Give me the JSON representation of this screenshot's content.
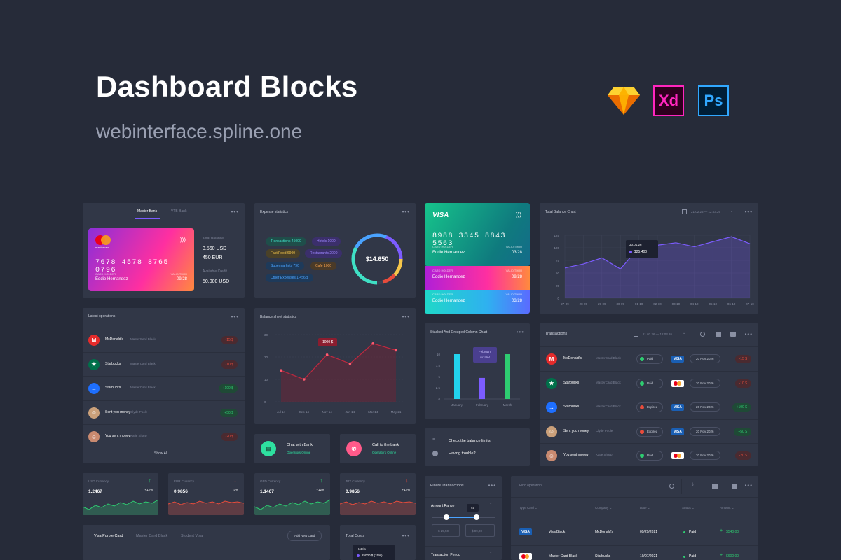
{
  "hero": {
    "title": "Dashboard Blocks",
    "subtitle": "webinterface.spline.one",
    "tools": [
      "sketch-icon",
      "Xd",
      "Ps"
    ]
  },
  "bank_panel": {
    "tabs": [
      "Master Bank",
      "VTB Bank"
    ],
    "card_number": "7678 4578 8765 0796",
    "card_brand": "mastercard",
    "card_holder_label": "CARD HOLDER",
    "card_holder": "Eddie Hernandez",
    "valid_label": "VALID THRU",
    "valid": "09/28",
    "total_label": "Total Balance",
    "usd": "3.560 USD",
    "eur": "450 EUR",
    "credit_label": "Available Credit",
    "credit": "50.000 USD"
  },
  "expense": {
    "title": "Expense statistics",
    "tags": [
      "Transactions 45000",
      "Hotels 1000",
      "Fast Food 6900",
      "Restaurants 2000",
      "Supermarkets 790",
      "Cafe 1000",
      "Other Expenses 1.456 $"
    ],
    "total": "$14.650"
  },
  "cards_stack": {
    "brand": "VISA",
    "number": "8988 3345 8843 5563",
    "holder_label": "CARD HOLDER",
    "valid_label": "VALID THRU",
    "holder": "Eddie Hernandez",
    "valid": "03/28",
    "card2_holder": "Eddie Hernandez",
    "card2_valid": "09/28",
    "card3_holder": "Eddie Hernandez",
    "card3_valid": "03/28"
  },
  "balance_chart": {
    "title": "Total Balance Chart",
    "range": "21.02.26 — 12.03.26",
    "tooltip_date": "30.01.26",
    "tooltip_value": "$25.400"
  },
  "latest_ops": {
    "title": "Latest operations",
    "rows": [
      {
        "name": "McDonald's",
        "card": "MasterCard Black",
        "amount": "-15 $"
      },
      {
        "name": "Starbucks",
        "card": "MasterCard Black",
        "amount": "-10 $"
      },
      {
        "name": "Starbucks",
        "card": "MasterCard Black",
        "amount": "+100 $"
      },
      {
        "name": "Sent you money",
        "card": "Clyde Poole",
        "amount": "+50 $"
      },
      {
        "name": "You sent money",
        "card": "Katie Sharp",
        "amount": "-20 $"
      }
    ],
    "show_all": "Show All"
  },
  "balance_sheet": {
    "title": "Balance sheet statistics",
    "tooltip": "1000 $"
  },
  "stacked": {
    "title": "Stacked And Grouped Column Chart",
    "tooltip_month": "February",
    "tooltip_value": "$7.400"
  },
  "transactions": {
    "title": "Transactions",
    "range": "21.02.26 — 12.03.26",
    "rows": [
      {
        "name": "McDonald's",
        "card": "MasterCard Black",
        "status": "Paid",
        "date": "20 Nov 2026",
        "amount": "-15 $"
      },
      {
        "name": "Starbucks",
        "card": "MasterCard Black",
        "status": "Paid",
        "date": "20 Nov 2026",
        "amount": "-10 $"
      },
      {
        "name": "Starbucks",
        "card": "MasterCard Black",
        "status": "Expired",
        "date": "20 Nov 2026",
        "amount": "+100 $"
      },
      {
        "name": "Sent you money",
        "card": "Clyde Poole",
        "status": "Expired",
        "date": "20 Nov 2026",
        "amount": "+50 $"
      },
      {
        "name": "You sent money",
        "card": "Katie Sharp",
        "status": "Paid",
        "date": "20 Nov 2026",
        "amount": "-20 $"
      }
    ]
  },
  "chat": {
    "chat_title": "Chat with Bank",
    "chat_sub": "Operators Online",
    "call_title": "Call to the bank",
    "call_sub": "Operators Online"
  },
  "help": {
    "item1": "Check the balance limits",
    "item2": "Having trouble?"
  },
  "currencies": [
    {
      "name": "USD Currency",
      "value": "1.2467",
      "change": "+12%"
    },
    {
      "name": "EUR Currency",
      "value": "0.9856",
      "change": "-3%"
    },
    {
      "name": "GPD Currency",
      "value": "1.1467",
      "change": "+12%"
    },
    {
      "name": "JPY Currency",
      "value": "0.9856",
      "change": "+12%"
    }
  ],
  "filters": {
    "title": "Filters Transactions",
    "amount_label": "Amount Range",
    "slider_value": "45",
    "min": "$ 25,50",
    "max": "$ 99,00",
    "period_label": "Transaction Period"
  },
  "find": {
    "placeholder": "Find operation",
    "columns": [
      "Type Card",
      "Company",
      "Date",
      "Status",
      "Amount"
    ],
    "rows": [
      {
        "type": "Visa Black",
        "company": "McDonald's",
        "date": "09/29/2021",
        "status": "Paid",
        "amount": "$540.00"
      },
      {
        "type": "Master Card Black",
        "company": "Starbucks",
        "date": "10/07/2021",
        "status": "Paid",
        "amount": "$600.00"
      }
    ]
  },
  "cards_tabs": {
    "tabs": [
      "Visa Purple Card",
      "Master Card Black",
      "Student Visa"
    ],
    "add": "Add New Card"
  },
  "total_costs": {
    "title": "Total Costs",
    "item": "Hotels",
    "value": "25000 $ (15%)"
  },
  "colors": {
    "bg": "#262b39",
    "panel": "#313747",
    "accent": "#7c5cff",
    "green": "#2ecc71",
    "red": "#e74c3c"
  },
  "chart_data": [
    {
      "type": "line",
      "title": "Total Balance Chart",
      "x": [
        "27-09",
        "28-09",
        "29-09",
        "30-09",
        "01-10",
        "02-10",
        "03-10",
        "04-10",
        "05-10",
        "06-10",
        "07-10"
      ],
      "y_ticks": [
        "125",
        "100",
        "75",
        "50",
        "25",
        "0"
      ],
      "values": [
        60,
        68,
        80,
        58,
        100,
        105,
        110,
        102,
        112,
        122,
        108
      ],
      "ylim": [
        0,
        125
      ]
    },
    {
      "type": "line",
      "title": "Balance sheet statistics",
      "x": [
        "Jul 14",
        "Sep 14",
        "Nov 14",
        "Jan 14",
        "Mar 14",
        "May 21"
      ],
      "y_ticks": [
        "30",
        "20",
        "10",
        "0"
      ],
      "values": [
        14,
        10,
        21,
        17,
        26,
        23
      ],
      "ylim": [
        0,
        30
      ]
    },
    {
      "type": "bar",
      "title": "Stacked And Grouped Column Chart",
      "categories": [
        "January",
        "February",
        "March"
      ],
      "y_ticks": [
        "10",
        "7.5",
        "5",
        "2.5",
        "0"
      ],
      "series": [
        {
          "values": [
            10,
            4.7,
            10
          ]
        }
      ],
      "ylim": [
        0,
        10
      ]
    }
  ]
}
